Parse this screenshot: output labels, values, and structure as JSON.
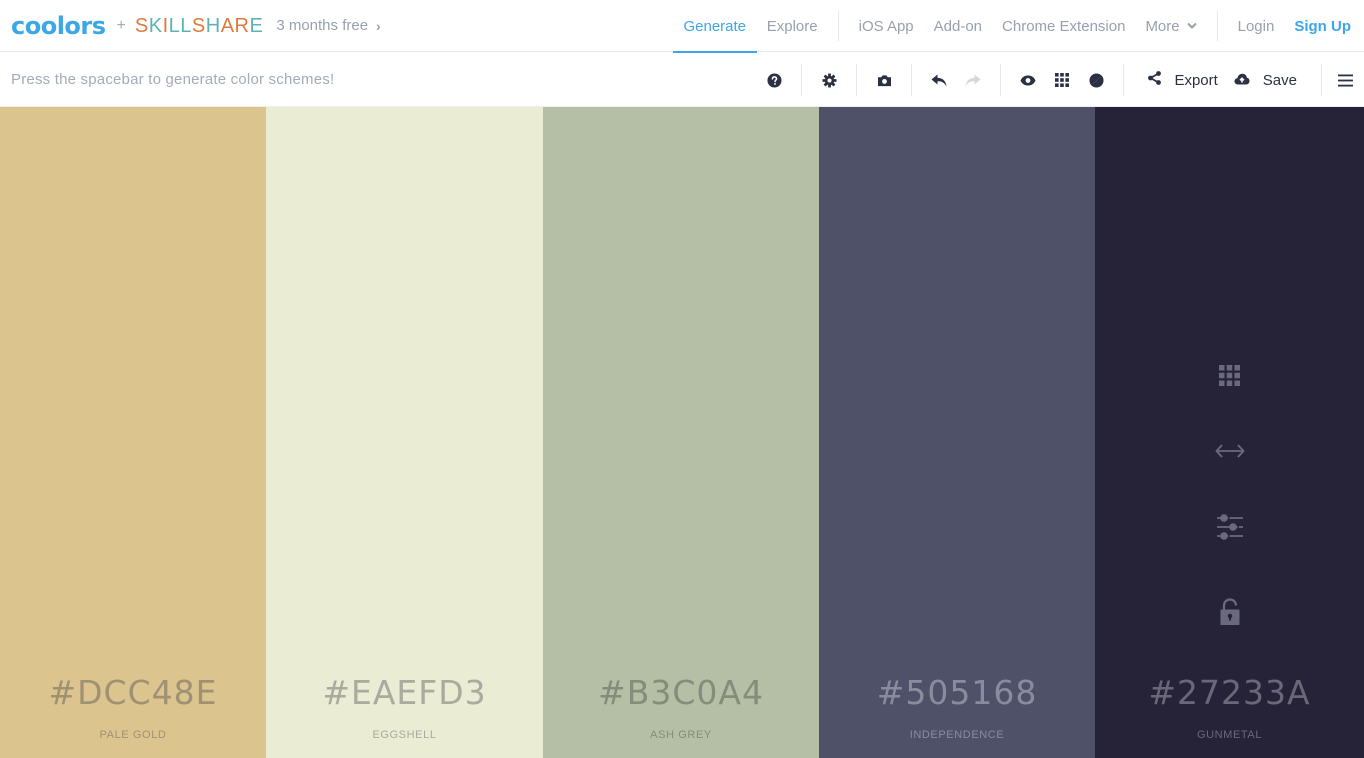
{
  "nav": {
    "logo": "coolors",
    "plus": "+",
    "partner": {
      "letters": [
        {
          "ch": "S",
          "color": "#e07a3c"
        },
        {
          "ch": "K",
          "color": "#5eb3b0"
        },
        {
          "ch": "I",
          "color": "#e07a3c"
        },
        {
          "ch": "L",
          "color": "#5eb3b0"
        },
        {
          "ch": "L",
          "color": "#5eb3b0"
        },
        {
          "ch": "S",
          "color": "#e07a3c"
        },
        {
          "ch": "H",
          "color": "#5eb3b0"
        },
        {
          "ch": "A",
          "color": "#e07a3c"
        },
        {
          "ch": "R",
          "color": "#e07a3c"
        },
        {
          "ch": "E",
          "color": "#5eb3b0"
        }
      ]
    },
    "promo": "3 months free",
    "links": {
      "generate": "Generate",
      "explore": "Explore",
      "ios": "iOS App",
      "addon": "Add-on",
      "chrome": "Chrome Extension",
      "more": "More",
      "login": "Login",
      "signup": "Sign Up"
    },
    "accent": "#3ca7e8"
  },
  "toolbar": {
    "hint": "Press the spacebar to generate color schemes!",
    "icons": [
      "help-icon",
      "settings-icon",
      "camera-icon",
      "undo-icon",
      "redo-icon",
      "view-icon",
      "grid-icon",
      "contrast-icon"
    ],
    "export_label": "Export",
    "save_label": "Save"
  },
  "palette": [
    {
      "hex": "#DCC48E",
      "name": "PALE GOLD",
      "bg": "#dcc48e",
      "fg": "#9e9174",
      "active": false
    },
    {
      "hex": "#EAEFD3",
      "name": "EGGSHELL",
      "bg": "#eaecd4",
      "fg": "#a8ab9d",
      "active": false
    },
    {
      "hex": "#B3C0A4",
      "name": "ASH GREY",
      "bg": "#b5bfa5",
      "fg": "#858c7c",
      "active": false
    },
    {
      "hex": "#505168",
      "name": "INDEPENDENCE",
      "bg": "#4e5168",
      "fg": "#8a8c9e",
      "active": false
    },
    {
      "hex": "#27233A",
      "name": "GUNMETAL",
      "bg": "#262339",
      "fg": "#6a6878",
      "active": true
    }
  ],
  "swatch_tools": [
    "grid-icon",
    "drag-arrows-icon",
    "adjust-sliders-icon",
    "lock-icon"
  ]
}
